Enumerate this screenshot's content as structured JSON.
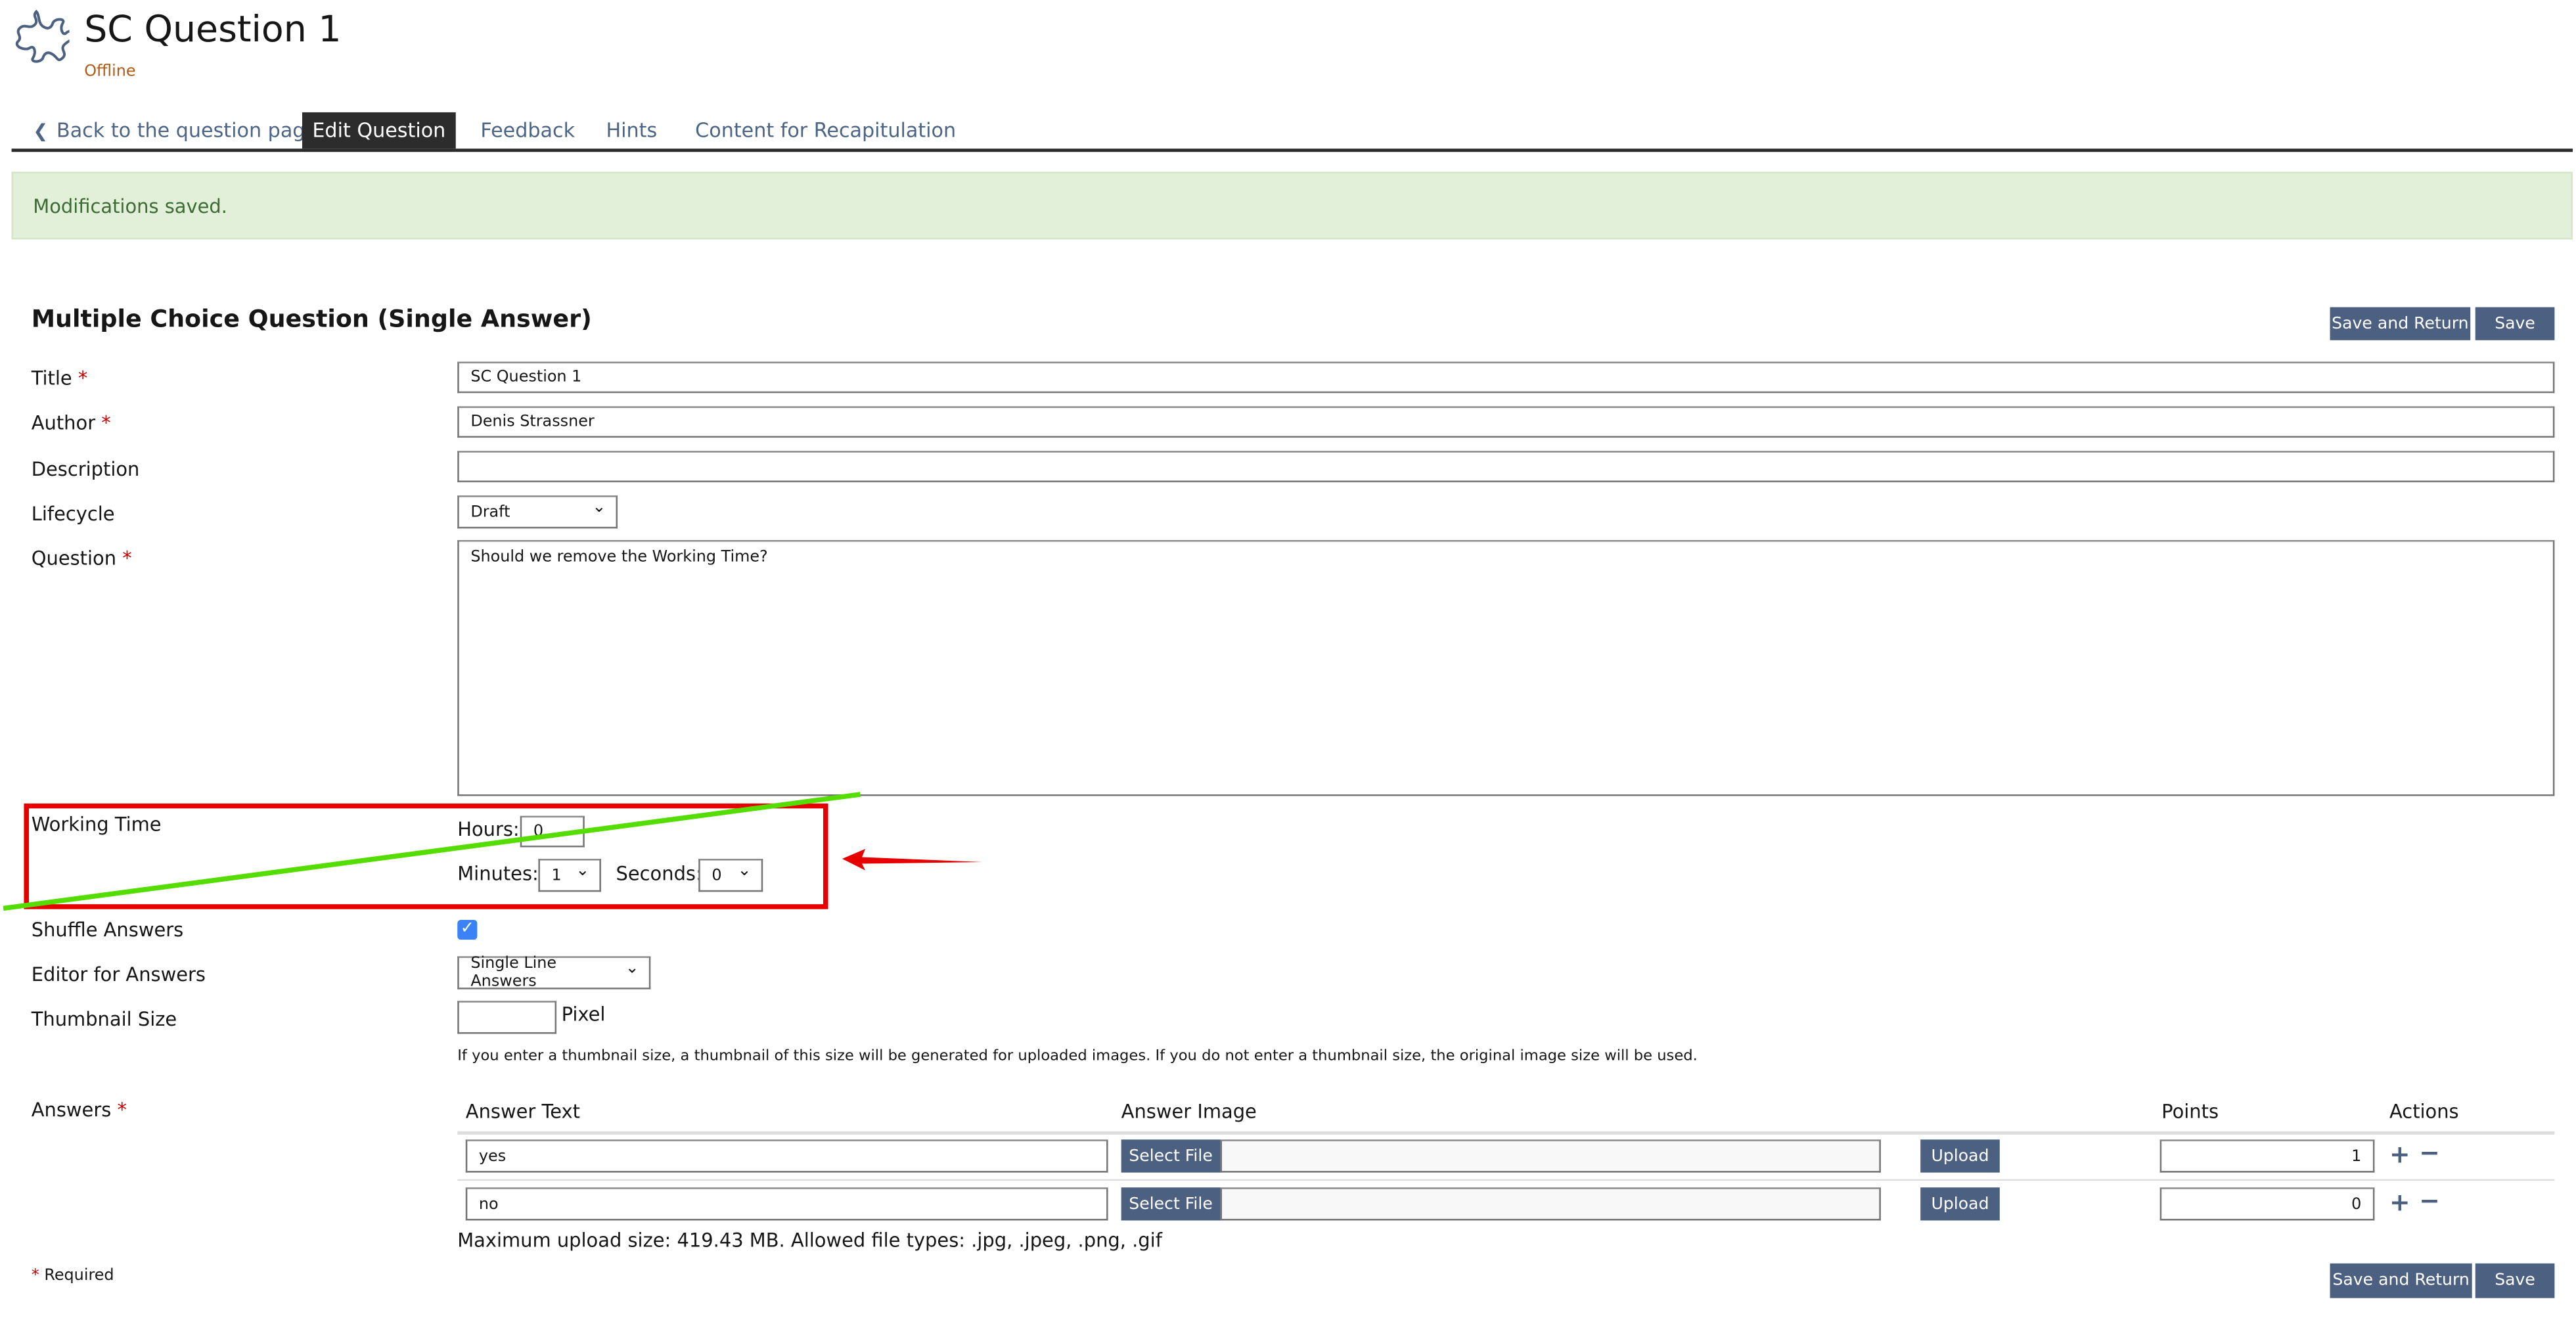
{
  "header": {
    "title": "SC Question 1",
    "status": "Offline",
    "icon": "puzzle-icon"
  },
  "tabs": [
    {
      "label": "Back to the question page",
      "icon": "chevron-left-icon"
    },
    {
      "label": "Edit Question",
      "active": true
    },
    {
      "label": "Feedback"
    },
    {
      "label": "Hints"
    },
    {
      "label": "Content for Recapitulation"
    }
  ],
  "alert": {
    "message": "Modifications saved."
  },
  "form": {
    "heading": "Multiple Choice Question (Single Answer)",
    "save_return_label": "Save and Return",
    "save_label": "Save",
    "required_mark": "*",
    "title": {
      "label": "Title",
      "value": "SC Question 1"
    },
    "author": {
      "label": "Author",
      "value": "Denis Strassner"
    },
    "description": {
      "label": "Description",
      "value": ""
    },
    "lifecycle": {
      "label": "Lifecycle",
      "value": "Draft"
    },
    "question": {
      "label": "Question",
      "value": "Should we remove the Working Time?"
    },
    "working_time": {
      "label": "Working Time",
      "hours_label": "Hours:",
      "hours": "0",
      "minutes_label": "Minutes:",
      "minutes": "1",
      "seconds_label": "Seconds:",
      "seconds": "0"
    },
    "shuffle": {
      "label": "Shuffle Answers",
      "checked": true
    },
    "editor": {
      "label": "Editor for Answers",
      "value": "Single Line Answers"
    },
    "thumbnail": {
      "label": "Thumbnail Size",
      "value": "",
      "unit": "Pixel",
      "info": "If you enter a thumbnail size, a thumbnail of this size will be generated for uploaded images. If you do not enter a thumbnail size, the original image size will be used."
    },
    "answers": {
      "label": "Answers",
      "headers": [
        "Answer Text",
        "Answer Image",
        "Points",
        "Actions"
      ],
      "rows": [
        {
          "text": "yes",
          "points": "1"
        },
        {
          "text": "no",
          "points": "0"
        }
      ],
      "select_file_label": "Select File",
      "upload_label": "Upload",
      "max_upload": "Maximum upload size: 419.43 MB. Allowed file types: .jpg, .jpeg, .png, .gif"
    },
    "required_note": "Required"
  },
  "colors": {
    "accent": "#4c6082",
    "tab_text": "#4c6586",
    "status": "#b05a17",
    "alert_bg": "#e2efd9",
    "annotation_box": "#e60000",
    "annotation_line": "#55dd00"
  }
}
